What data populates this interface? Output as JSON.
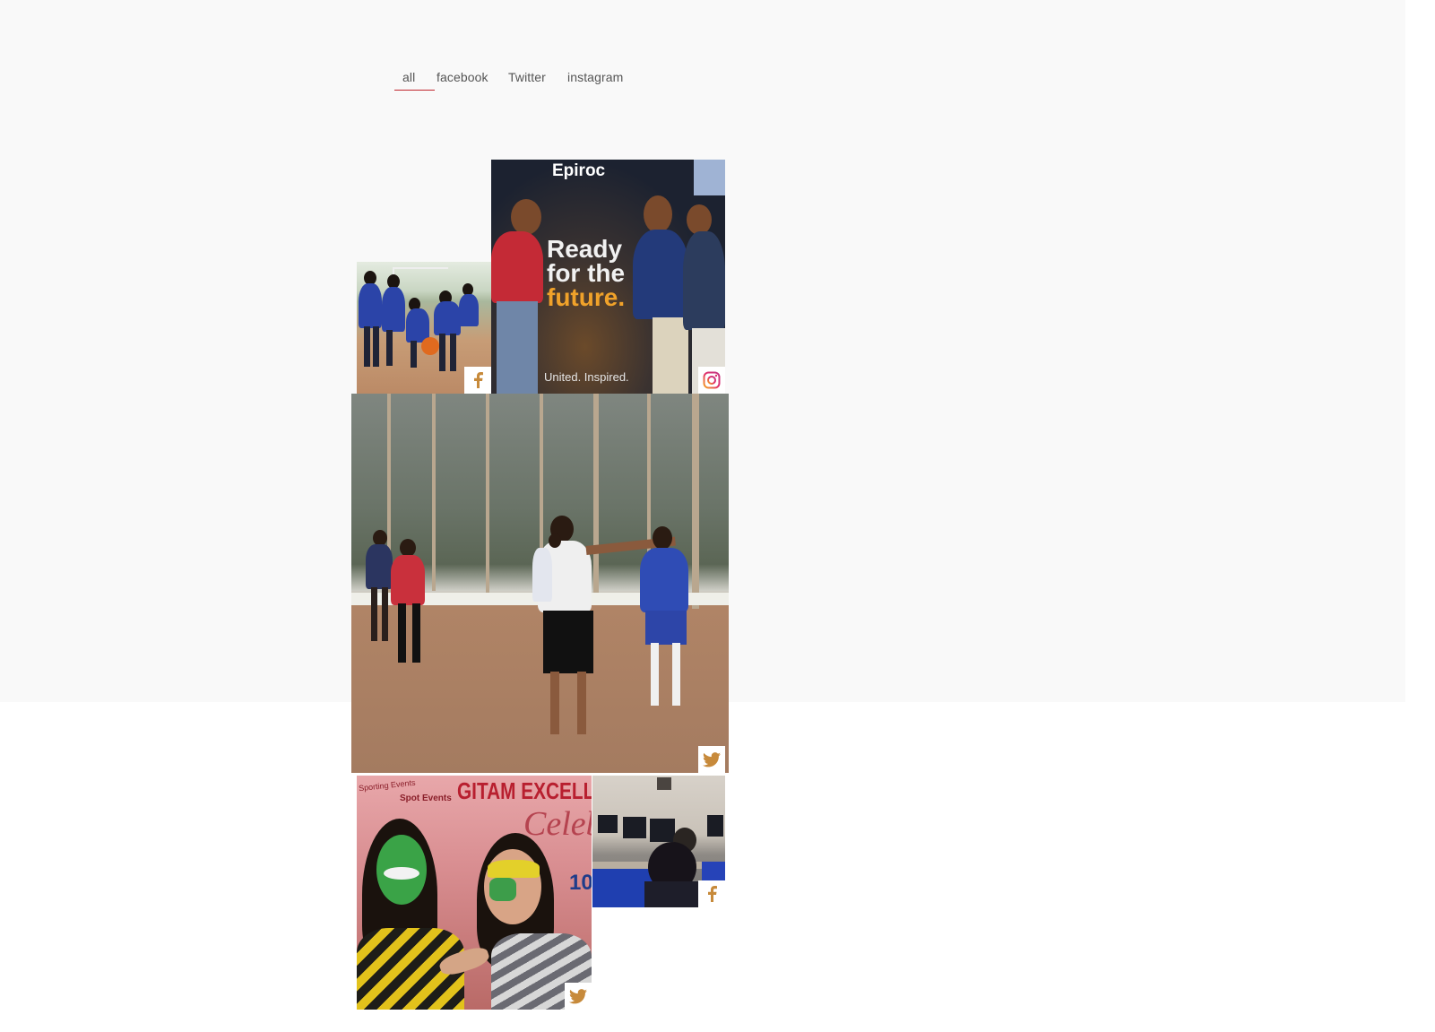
{
  "tabs": [
    {
      "label": "all",
      "active": true
    },
    {
      "label": "facebook",
      "active": false
    },
    {
      "label": "Twitter",
      "active": false
    },
    {
      "label": "instagram",
      "active": false
    }
  ],
  "accent_color": "#c0262d",
  "badge_color": "#c78a3b",
  "feed": [
    {
      "source": "facebook",
      "icon": "facebook-icon"
    },
    {
      "source": "instagram",
      "icon": "instagram-icon",
      "poster": {
        "brand": "Epiroc",
        "headline_1": "Ready",
        "headline_2": "for the",
        "headline_3": "future.",
        "tagline": "United. Inspired."
      }
    },
    {
      "source": "Twitter",
      "icon": "twitter-icon"
    },
    {
      "source": "Twitter",
      "icon": "twitter-icon",
      "banner": {
        "title": "GITAM EXCELL",
        "script": "Celebr",
        "number": "10",
        "left_text": "Sporting Events",
        "spot_text": "Spot Events"
      }
    },
    {
      "source": "facebook",
      "icon": "facebook-icon"
    }
  ]
}
